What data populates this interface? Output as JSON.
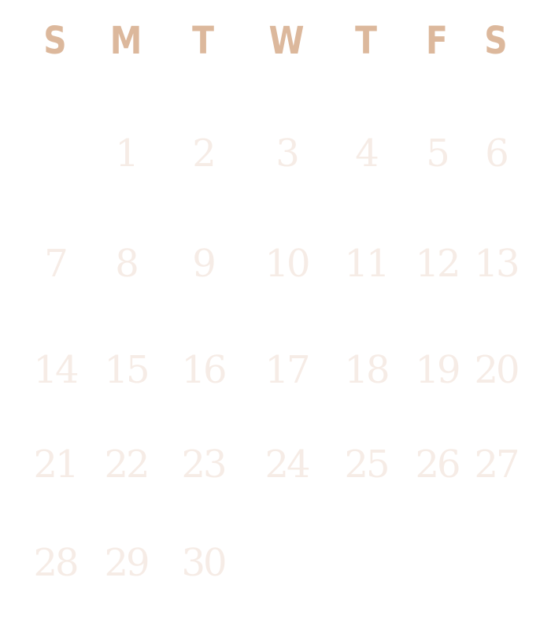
{
  "calendar": {
    "header_color": "#dcb89c",
    "day_color": "#f6ece6",
    "weekdays": [
      "S",
      "M",
      "T",
      "W",
      "T",
      "F",
      "S"
    ],
    "days": [
      "1",
      "2",
      "3",
      "4",
      "5",
      "6",
      "7",
      "8",
      "9",
      "10",
      "11",
      "12",
      "13",
      "14",
      "15",
      "16",
      "17",
      "18",
      "19",
      "20",
      "21",
      "22",
      "23",
      "24",
      "25",
      "26",
      "27",
      "28",
      "29",
      "30"
    ]
  }
}
